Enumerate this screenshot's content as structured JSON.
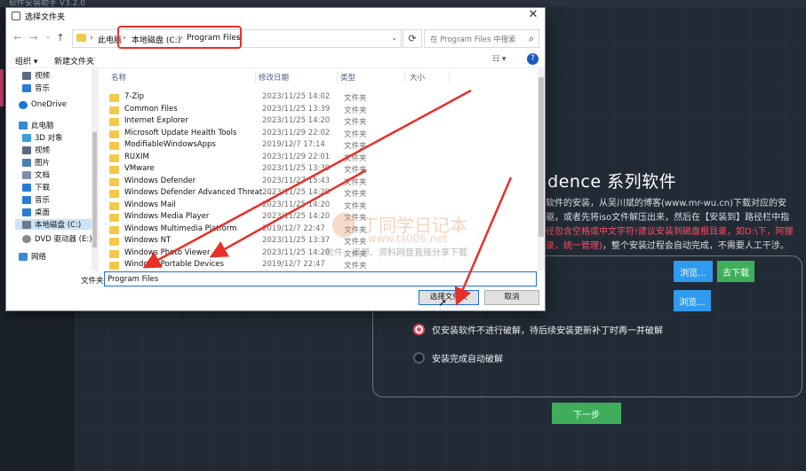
{
  "app": {
    "title": "软件安装助手 V3.2.0",
    "heading": "adence 系列软件",
    "desc_line1": "列软件的安装，从吴川斌的博客(www.mr-wu.cn)下载对应的安",
    "desc_line2": "先驱，或者先将iso文件解压出来，然后在【安装到】路径栏中指",
    "desc_warn1": "路径包含空格或中文字符!建议安装到磁盘根目录，如D:\\下，阿狸",
    "desc_warn2": "目录，统一管理)",
    "desc_tail": "，整个安装过程会自动完成，不需要人工干涉。",
    "browse1": "浏览...",
    "download": "去下载",
    "browse2": "浏览...",
    "option1": "仅安装软件不进行破解，待后续安装更新补丁时再一并破解",
    "option2": "安装完成自动破解",
    "option1_selected": true,
    "next": "下一步"
  },
  "dialog": {
    "title": "选择文件夹",
    "close": "✕",
    "address": [
      "此电脑",
      "本地磁盘 (C:)",
      "Program Files"
    ],
    "search_placeholder": "在 Program Files 中搜索",
    "organize": "组织 ▾",
    "new_folder": "新建文件夹",
    "tree": [
      {
        "label": "视频",
        "color": "#5a6a82"
      },
      {
        "label": "音乐",
        "color": "#2a7bd6"
      },
      {
        "label": "OneDrive",
        "color": "#1e74d6"
      },
      {
        "label": "此电脑",
        "color": "#3a8ad8"
      },
      {
        "label": "3D 对象",
        "color": "#3aa0d8"
      },
      {
        "label": "视频",
        "color": "#5a6a82"
      },
      {
        "label": "图片",
        "color": "#4a7fb5"
      },
      {
        "label": "文档",
        "color": "#7c8ea8"
      },
      {
        "label": "下载",
        "color": "#2a7bd6"
      },
      {
        "label": "音乐",
        "color": "#2a7bd6"
      },
      {
        "label": "桌面",
        "color": "#2a7bd6"
      },
      {
        "label": "本地磁盘 (C:)",
        "color": "#6a7a90"
      },
      {
        "label": "DVD 驱动器 (E:)",
        "color": "#888"
      },
      {
        "label": "网络",
        "color": "#3a8ad8"
      }
    ],
    "columns": {
      "name": "名称",
      "date": "修改日期",
      "type": "类型",
      "size": "大小"
    },
    "files": [
      {
        "name": "7-Zip",
        "date": "2023/11/25 14:02",
        "type": "文件夹"
      },
      {
        "name": "Common Files",
        "date": "2023/11/25 13:39",
        "type": "文件夹"
      },
      {
        "name": "Internet Explorer",
        "date": "2023/11/25 14:20",
        "type": "文件夹"
      },
      {
        "name": "Microsoft Update Health Tools",
        "date": "2023/11/29 22:02",
        "type": "文件夹"
      },
      {
        "name": "ModifiableWindowsApps",
        "date": "2019/12/7 17:14",
        "type": "文件夹"
      },
      {
        "name": "RUXIM",
        "date": "2023/11/29 22:01",
        "type": "文件夹"
      },
      {
        "name": "VMware",
        "date": "2023/11/25 13:39",
        "type": "文件夹"
      },
      {
        "name": "Windows Defender",
        "date": "2023/11/27 15:43",
        "type": "文件夹"
      },
      {
        "name": "Windows Defender Advanced Threat ...",
        "date": "2023/11/25 14:20",
        "type": "文件夹"
      },
      {
        "name": "Windows Mail",
        "date": "2023/11/25 14:20",
        "type": "文件夹"
      },
      {
        "name": "Windows Media Player",
        "date": "2023/11/25 14:20",
        "type": "文件夹"
      },
      {
        "name": "Windows Multimedia Platform",
        "date": "2019/12/7 22:47",
        "type": "文件夹"
      },
      {
        "name": "Windows NT",
        "date": "2023/11/25 13:37",
        "type": "文件夹"
      },
      {
        "name": "Windows Photo Viewer",
        "date": "2023/11/25 14:20",
        "type": "文件夹"
      },
      {
        "name": "Windows Portable Devices",
        "date": "2019/12/7 22:47",
        "type": "文件夹"
      }
    ],
    "folder_label": "文件夹:",
    "folder_value": "Program Files",
    "select_button": "选择文件夹",
    "cancel_button": "取消"
  },
  "watermark": {
    "line1": "丁同学日记本",
    "line2": "www.ts006.net",
    "line3": "软件、资源、资料网盘直接分享下载"
  },
  "colors": {
    "annotation_red": "#e8302a",
    "accent_blue": "#2e9bf0",
    "accent_green": "#3fae5a"
  }
}
